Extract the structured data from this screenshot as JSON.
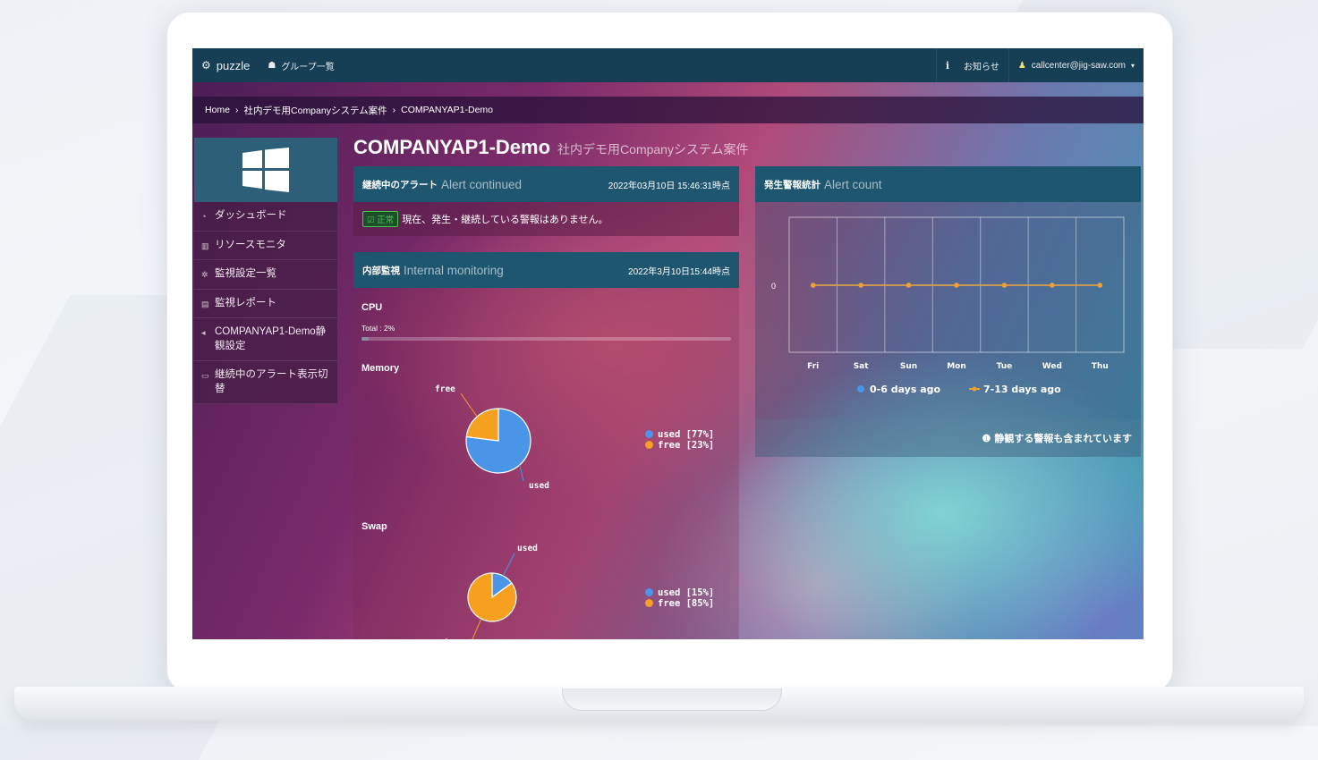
{
  "topbar": {
    "brand": "puzzle",
    "groups": "グループ一覧",
    "info": "お知らせ",
    "user": "callcenter@jig-saw.com"
  },
  "breadcrumb": [
    "Home",
    "社内デモ用Companyシステム案件",
    "COMPANYAP1-Demo"
  ],
  "sidebar": {
    "items": [
      {
        "icon": "dashboard-icon",
        "label": "ダッシュボード"
      },
      {
        "icon": "chart-icon",
        "label": "リソースモニタ"
      },
      {
        "icon": "gear-icon",
        "label": "監視設定一覧"
      },
      {
        "icon": "report-icon",
        "label": "監視レポート"
      },
      {
        "icon": "chevron-left-icon",
        "label": "COMPANYAP1-Demo静観設定"
      },
      {
        "icon": "monitor-icon",
        "label": "継続中のアラート表示切替"
      }
    ]
  },
  "page": {
    "title": "COMPANYAP1-Demo",
    "subtitle": "社内デモ用Companyシステム案件"
  },
  "alert_panel": {
    "title_ja": "継続中のアラート",
    "title_en": "Alert continued",
    "timestamp": "2022年03月10日 15:46:31時点",
    "badge": "正常",
    "message": "現在、発生・継続している警報はありません。"
  },
  "monitor_panel": {
    "title_ja": "内部監視",
    "title_en": "Internal monitoring",
    "timestamp": "2022年3月10日15:44時点",
    "cpu_label": "CPU",
    "cpu_total_label": "Total : 2%",
    "cpu_value": 2,
    "memory_label": "Memory",
    "swap_label": "Swap"
  },
  "count_panel": {
    "title_ja": "発生警報統計",
    "title_en": "Alert count",
    "footer": "静観する警報も含まれています"
  },
  "colors": {
    "used": "#4a95e8",
    "free": "#f5a01e",
    "line": "#f0a030"
  },
  "chart_data": [
    {
      "type": "pie",
      "slices": [
        {
          "name": "used",
          "value": 77
        },
        {
          "name": "free",
          "value": 23
        }
      ],
      "legend": [
        "used [77%]",
        "free [23%]"
      ]
    },
    {
      "type": "pie",
      "slices": [
        {
          "name": "used",
          "value": 15
        },
        {
          "name": "free",
          "value": 85
        }
      ],
      "legend": [
        "used [15%]",
        "free [85%]"
      ]
    },
    {
      "type": "line",
      "categories": [
        "Fri",
        "Sat",
        "Sun",
        "Mon",
        "Tue",
        "Wed",
        "Thu"
      ],
      "series": [
        {
          "name": "0-6 days ago",
          "values": [
            0,
            0,
            0,
            0,
            0,
            0,
            0
          ]
        },
        {
          "name": "7-13 days ago",
          "values": [
            0,
            0,
            0,
            0,
            0,
            0,
            0
          ]
        }
      ],
      "yticks": [
        "0"
      ],
      "grid": true,
      "legend_position": "bottom"
    }
  ]
}
